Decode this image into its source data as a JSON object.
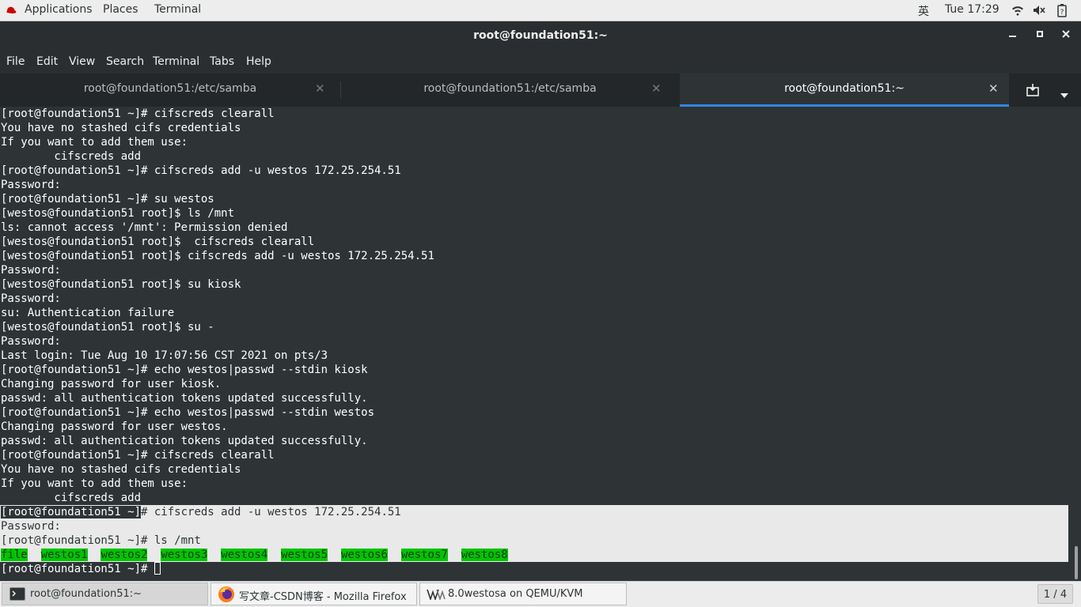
{
  "topbar": {
    "applications": "Applications",
    "places": "Places",
    "terminal": "Terminal",
    "input_method": "英",
    "clock": "Tue 17:29"
  },
  "window": {
    "title": "root@foundation51:~"
  },
  "menu": [
    "File",
    "Edit",
    "View",
    "Search",
    "Terminal",
    "Tabs",
    "Help"
  ],
  "tabs": [
    {
      "label": "root@foundation51:/etc/samba"
    },
    {
      "label": "root@foundation51:/etc/samba"
    },
    {
      "label": "root@foundation51:~"
    }
  ],
  "terminal": {
    "lines": [
      "[root@foundation51 ~]# cifscreds clearall",
      "You have no stashed cifs credentials",
      "If you want to add them use:",
      "        cifscreds add",
      "[root@foundation51 ~]# cifscreds add -u westos 172.25.254.51",
      "Password:",
      "[root@foundation51 ~]# su westos",
      "[westos@foundation51 root]$ ls /mnt",
      "ls: cannot access '/mnt': Permission denied",
      "[westos@foundation51 root]$  cifscreds clearall",
      "[westos@foundation51 root]$ cifscreds add -u westos 172.25.254.51",
      "Password:",
      "[westos@foundation51 root]$ su kiosk",
      "Password:",
      "su: Authentication failure",
      "[westos@foundation51 root]$ su -",
      "Password:",
      "Last login: Tue Aug 10 17:07:56 CST 2021 on pts/3",
      "[root@foundation51 ~]# echo westos|passwd --stdin kiosk",
      "Changing password for user kiosk.",
      "passwd: all authentication tokens updated successfully.",
      "[root@foundation51 ~]# echo westos|passwd --stdin westos",
      "Changing password for user westos.",
      "passwd: all authentication tokens updated successfully.",
      "[root@foundation51 ~]# cifscreds clearall",
      "You have no stashed cifs credentials",
      "If you want to add them use:",
      "        cifscreds add"
    ],
    "prompt": "[root@foundation51 ~]",
    "sel_cmd1": "# cifscreds add -u westos 172.25.254.51",
    "sel_password": "Password:",
    "sel_cmd2": "# ls /mnt",
    "ls_output": [
      "file",
      "westos1",
      "westos2",
      "westos3",
      "westos4",
      "westos5",
      "westos6",
      "westos7",
      "westos8"
    ],
    "final_prompt": "[root@foundation51 ~]# "
  },
  "taskbar": {
    "items": [
      {
        "label": "root@foundation51:~"
      },
      {
        "label": "写文章-CSDN博客 - Mozilla Firefox"
      },
      {
        "label": "8.0westosa on QEMU/KVM"
      }
    ],
    "workspace": "1 / 4"
  }
}
